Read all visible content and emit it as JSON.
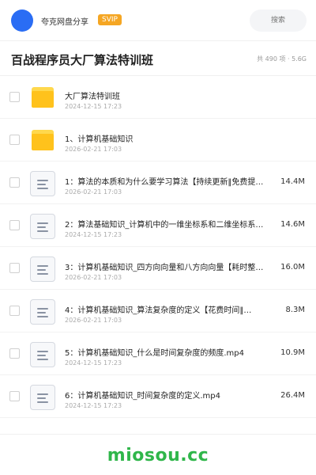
{
  "header": {
    "username": "夸克网盘分享",
    "badge": "SVIP",
    "search_placeholder": "搜索"
  },
  "folder": {
    "title": "百战程序员大厂算法特训班",
    "summary": "共 490 项 · 5.6G"
  },
  "items": [
    {
      "type": "folder",
      "name": "大厂算法特训班",
      "date": "2024-12-15 17:23",
      "size": ""
    },
    {
      "type": "folder",
      "name": "1、计算机基础知识",
      "date": "2026-02-21 17:03",
      "size": ""
    },
    {
      "type": "file",
      "name": "1：算法的本质和为什么要学习算法【持续更新‖免费提…",
      "date": "2026-02-21 17:03",
      "size": "14.4M"
    },
    {
      "type": "file",
      "name": "2：算法基础知识_计算机中的一维坐标系和二维坐标系…",
      "date": "2024-12-15 17:23",
      "size": "14.6M"
    },
    {
      "type": "file",
      "name": "3：计算机基础知识_四方向向量和八方向向量【耗时整…",
      "date": "2026-02-21 17:03",
      "size": "16.0M"
    },
    {
      "type": "file",
      "name": "4：计算机基础知识_算法复杂度的定义【花费时间‖免…",
      "date": "2026-02-21 17:03",
      "size": "8.3M"
    },
    {
      "type": "file",
      "name": "5：计算机基础知识_什么是时间复杂度的频度.mp4",
      "date": "2024-12-15 17:23",
      "size": "10.9M"
    },
    {
      "type": "file",
      "name": "6：计算机基础知识_时间复杂度的定义.mp4",
      "date": "2024-12-15 17:23",
      "size": "26.4M"
    }
  ],
  "footer": {
    "brand": "miosou.cc",
    "brand_color": "#2fb64a"
  }
}
